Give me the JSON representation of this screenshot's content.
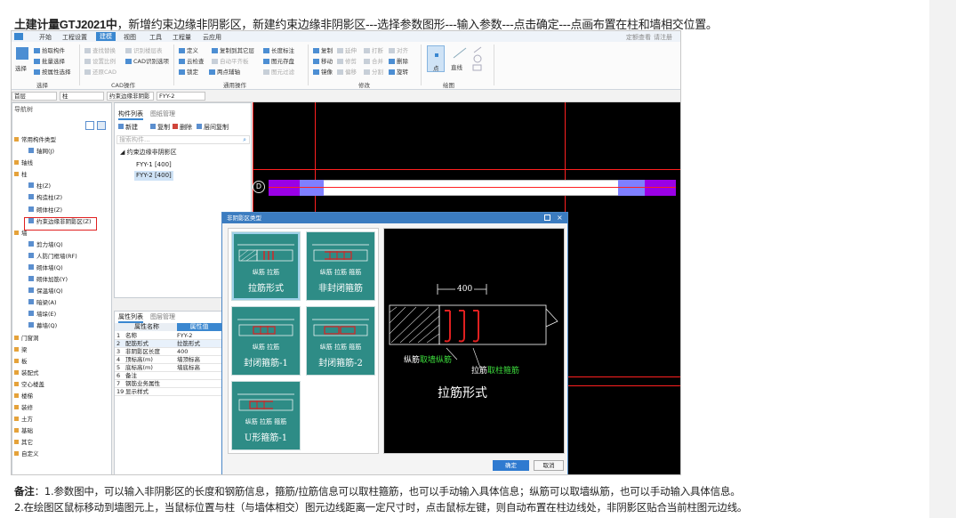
{
  "heading": {
    "bold": "土建计量GTJ2021中",
    "text": "，新增约束边缘非阴影区，新建约束边缘非阴影区---选择参数图形---输入参数---点击确定---点画布置在柱和墙相交位置。"
  },
  "menu": [
    "开始",
    "工程设置",
    "建模",
    "视图",
    "工具",
    "工程量",
    "云应用"
  ],
  "menu_active": "建模",
  "menu_right": [
    "定额查看",
    "请注册"
  ],
  "ribbon": {
    "select_label": "选择",
    "select_items": [
      "拾取构件",
      "批量选择",
      "按属性选择"
    ],
    "cad_items": [
      "查找替换",
      "设置比例",
      "还原CAD",
      "识别楼层表",
      "CAD识别选项"
    ],
    "general_items": [
      "定义",
      "云检查",
      "锁定",
      "两点辅轴",
      "复制到其它层",
      "自动平齐板",
      "图元存盘",
      "图元过滤",
      "长度标注"
    ],
    "modify_items": [
      "复制",
      "移动",
      "镜像",
      "延伸",
      "修剪",
      "偏移",
      "打断",
      "合并",
      "分割",
      "对齐",
      "删除",
      "旋转"
    ],
    "draw_items": [
      "点",
      "直线"
    ],
    "groups": [
      "选择",
      "CAD操作",
      "通用操作",
      "修改",
      "绘图"
    ]
  },
  "selectors": {
    "floor": "首层",
    "type": "柱",
    "subtype": "约束边缘非阴影",
    "item": "FYY-2"
  },
  "nav": {
    "title": "导航树",
    "items": [
      "常用构件类型",
      "轴网(J)",
      "轴线",
      "柱",
      "柱(Z)",
      "构造柱(Z)",
      "砌体柱(Z)",
      "约束边缘非阴影区(Z)",
      "墙",
      "剪力墙(Q)",
      "人防门框墙(RF)",
      "砌体墙(Q)",
      "砌体加筋(Y)",
      "保温墙(Q)",
      "暗梁(A)",
      "墙垛(E)",
      "幕墙(Q)",
      "门窗洞",
      "梁",
      "板",
      "装配式",
      "空心楼盖",
      "楼梯",
      "装修",
      "土方",
      "基础",
      "其它",
      "自定义"
    ]
  },
  "component_list": {
    "tabs": [
      "构件列表",
      "图纸管理"
    ],
    "toolbar": [
      "新建",
      "复制",
      "删除",
      "层间复制"
    ],
    "search_placeholder": "搜索构件...",
    "root": "约束边缘非阴影区",
    "items": [
      "FYY-1 [400]",
      "FYY-2 [400]"
    ]
  },
  "props": {
    "tabs": [
      "属性列表",
      "图层管理"
    ],
    "headers": [
      "属性名称",
      "属性值"
    ],
    "rows": [
      [
        "1",
        "名称",
        "FYY-2"
      ],
      [
        "2",
        "配筋形式",
        "拉筋形式"
      ],
      [
        "3",
        "非阴影区长度",
        "400"
      ],
      [
        "4",
        "顶标高(m)",
        "墙顶标高"
      ],
      [
        "5",
        "底标高(m)",
        "墙底标高"
      ],
      [
        "6",
        "备注",
        ""
      ],
      [
        "7",
        "钢筋业务属性",
        ""
      ],
      [
        "19",
        "显示样式",
        ""
      ]
    ]
  },
  "cad": {
    "axis_mark": "D"
  },
  "dialog": {
    "title": "非阴影区类型",
    "cards": [
      {
        "top": "纵筋  拉筋",
        "label": "拉筋形式"
      },
      {
        "top": "纵筋  拉筋  箍筋",
        "label": "非封闭箍筋"
      },
      {
        "top": "纵筋  拉筋",
        "label": "封闭箍筋-1"
      },
      {
        "top": "纵筋  拉筋  箍筋",
        "label": "封闭箍筋-2"
      },
      {
        "top": "纵筋  拉筋  箍筋",
        "label": "U形箍筋-1"
      }
    ],
    "preview": {
      "dim": "400",
      "long_bar": "纵筋",
      "long_bar_note": "取墙纵筋",
      "tie": "拉筋",
      "tie_note": "取柱箍筋",
      "title": "拉筋形式"
    },
    "ok": "确定",
    "cancel": "取消"
  },
  "notes": {
    "line1_bold": "备注",
    "line1": "：1.参数图中，可以输入非阴影区的长度和钢筋信息，箍筋/拉筋信息可以取柱箍筋，也可以手动输入具体信息；纵筋可以取墙纵筋，也可以手动输入具体信息。",
    "line2": "2.在绘图区鼠标移动到墙图元上，当鼠标位置与柱（与墙体相交）图元边线距离一定尺寸时，点击鼠标左键，则自动布置在柱边线处，非阴影区贴合当前柱图元边线。"
  },
  "colors": {
    "accent": "#3a87d0",
    "teal": "#2e8c86",
    "wall_purple": "#9a00e6",
    "wall_blue": "#7f7fff",
    "red": "#e02020"
  }
}
